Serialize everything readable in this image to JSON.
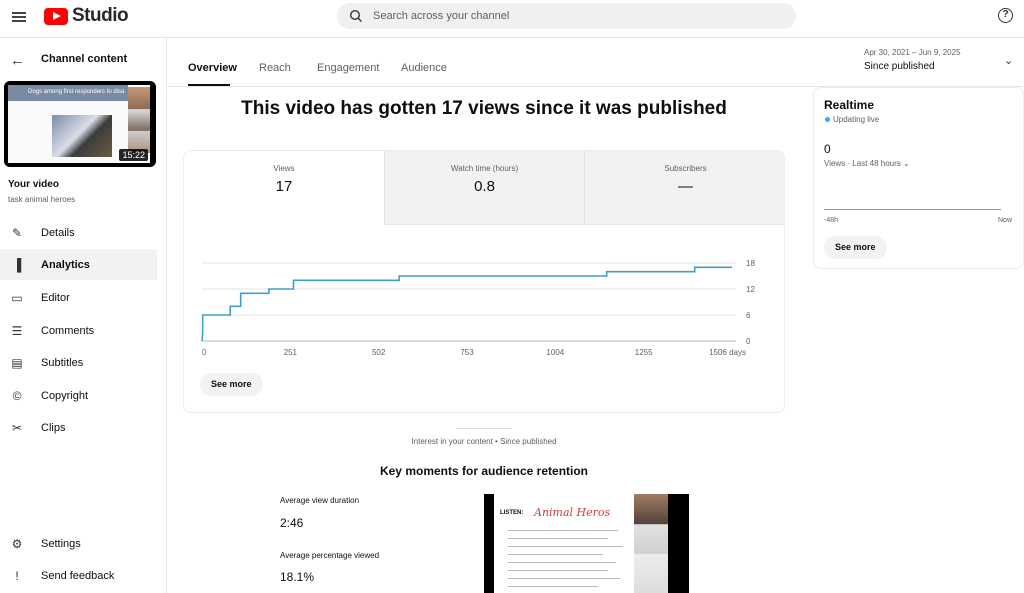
{
  "app": {
    "logo_text": "Studio",
    "search_placeholder": "Search across your channel"
  },
  "sidebar": {
    "title": "Channel content",
    "thumbnail": {
      "caption": "Dogs among first responders to disa",
      "duration": "15:22"
    },
    "your_video_label": "Your video",
    "video_title": "task animal heroes",
    "items": [
      {
        "label": "Details",
        "icon": "pencil-icon",
        "glyph": "✎",
        "active": false
      },
      {
        "label": "Analytics",
        "icon": "analytics-icon",
        "glyph": "▐",
        "active": true
      },
      {
        "label": "Editor",
        "icon": "film-icon",
        "glyph": "▭",
        "active": false
      },
      {
        "label": "Comments",
        "icon": "comment-icon",
        "glyph": "☰",
        "active": false
      },
      {
        "label": "Subtitles",
        "icon": "subtitles-icon",
        "glyph": "▤",
        "active": false
      },
      {
        "label": "Copyright",
        "icon": "copyright-icon",
        "glyph": "©",
        "active": false
      },
      {
        "label": "Clips",
        "icon": "scissors-icon",
        "glyph": "✂",
        "active": false
      }
    ],
    "bottom_items": [
      {
        "label": "Settings",
        "icon": "gear-icon",
        "glyph": "⚙"
      },
      {
        "label": "Send feedback",
        "icon": "feedback-icon",
        "glyph": "!"
      }
    ]
  },
  "tabs": [
    "Overview",
    "Reach",
    "Engagement",
    "Audience"
  ],
  "active_tab": "Overview",
  "date_range": {
    "range": "Apr 30, 2021 – Jun 9, 2025",
    "label": "Since published"
  },
  "headline": "This video has gotten 17 views since it was published",
  "metrics": [
    {
      "label": "Views",
      "value": "17"
    },
    {
      "label": "Watch time (hours)",
      "value": "0.8"
    },
    {
      "label": "Subscribers",
      "value": "—"
    }
  ],
  "see_more_label": "See more",
  "chart_data": {
    "type": "line",
    "x_ticks": [
      "0",
      "251",
      "502",
      "753",
      "1004",
      "1255",
      "1506 days"
    ],
    "y_ticks": [
      "0",
      "6",
      "12",
      "18"
    ],
    "xlim": [
      0,
      1506
    ],
    "ylim": [
      0,
      18
    ],
    "grid": true,
    "line_color": "#41a0c4",
    "x": [
      0,
      2,
      2,
      80,
      80,
      110,
      110,
      190,
      190,
      260,
      260,
      380,
      380,
      560,
      560,
      1150,
      1150,
      1400,
      1400,
      1506
    ],
    "y": [
      0,
      2,
      6,
      6,
      8,
      8,
      11,
      11,
      12,
      12,
      14,
      14,
      14,
      14,
      15,
      15,
      16,
      16,
      17,
      17
    ]
  },
  "realtime": {
    "title": "Realtime",
    "status": "Updating live",
    "value": "0",
    "range_label": "Views · Last 48 hours",
    "axis_left": "-48h",
    "axis_right": "Now"
  },
  "retention": {
    "interest_label": "Interest in your content • Since published",
    "title": "Key moments for audience retention",
    "avg_view_duration_label": "Average view duration",
    "avg_view_duration": "2:46",
    "avg_pct_viewed_label": "Average percentage viewed",
    "avg_pct_viewed": "18.1%",
    "preview": {
      "listen_text": "LISTEN:",
      "handwriting": "Animal Heros"
    }
  },
  "colors": {
    "accent": "#ff0000",
    "live_dot": "#3ea6ff"
  }
}
